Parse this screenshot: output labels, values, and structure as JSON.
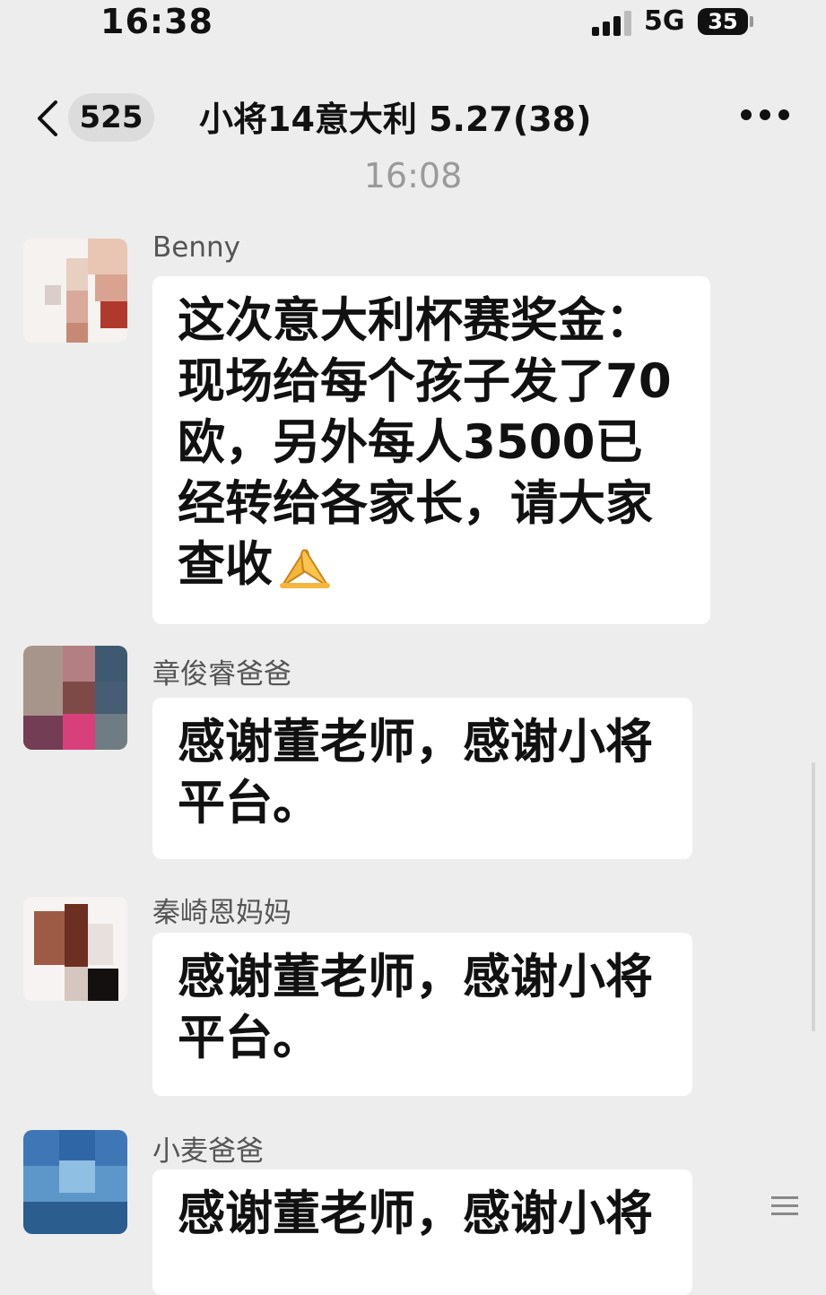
{
  "status_bar": {
    "time": "16:38",
    "network": "5G",
    "battery": "35"
  },
  "nav": {
    "unread_count": "525",
    "title": "小将14意大利 5.27(38)"
  },
  "timestamp": "16:08",
  "messages": [
    {
      "sender": "Benny",
      "lines": [
        "这次意大利杯赛奖金：",
        "现场给每个孩子发了70",
        "欧，另外每人3500已",
        "经转给各家长，请大家",
        "查收"
      ],
      "emoji": "pray-icon"
    },
    {
      "sender": "章俊睿爸爸",
      "lines": [
        "感谢董老师，感谢小将",
        "平台。"
      ]
    },
    {
      "sender": "秦崎恩妈妈",
      "lines": [
        "感谢董老师，感谢小将",
        "平台。"
      ]
    },
    {
      "sender": "小麦爸爸",
      "lines": [
        "感谢董老师，感谢小将"
      ]
    }
  ]
}
